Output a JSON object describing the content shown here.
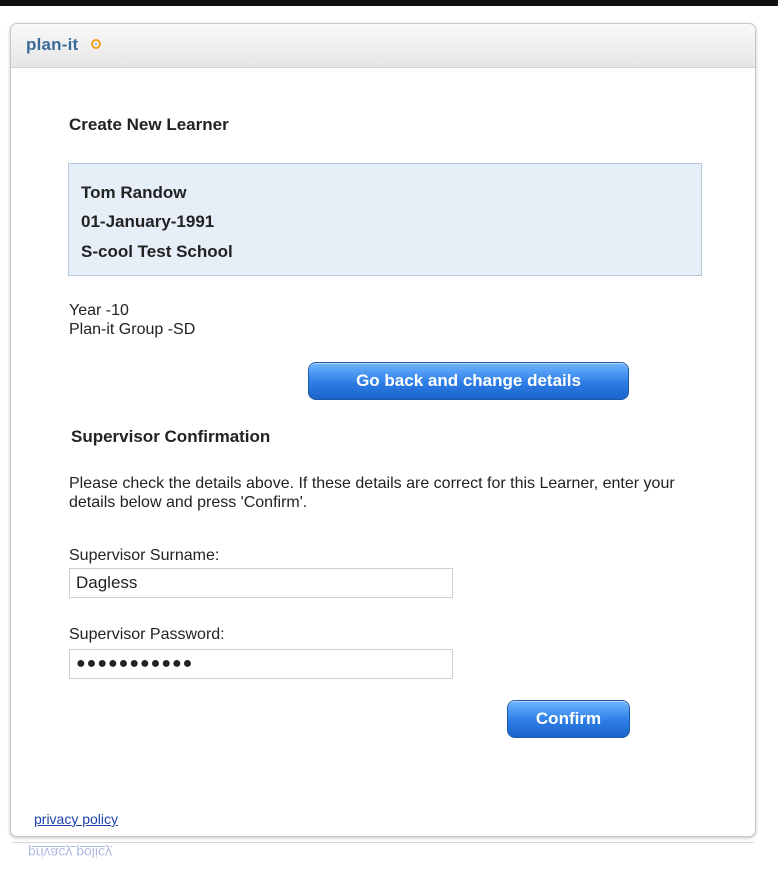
{
  "app": {
    "logo": "plan-it"
  },
  "page": {
    "title": "Create New Learner"
  },
  "learner": {
    "name": "Tom Randow",
    "dob": "01-January-1991",
    "school": "S-cool Test School",
    "year": "Year -10",
    "group": "Plan-it Group -SD"
  },
  "buttons": {
    "go_back": "Go back and change details",
    "confirm": "Confirm"
  },
  "supervisor": {
    "heading": "Supervisor Confirmation",
    "instructions": "Please check the details above. If these details are correct for this Learner, enter your details below and press 'Confirm'.",
    "surname_label": "Supervisor Surname:",
    "surname_value": "Dagless",
    "password_label": "Supervisor Password:",
    "password_value": "●●●●●●●●●●●"
  },
  "footer": {
    "privacy": "privacy policy"
  },
  "colors": {
    "accent": "#2c7de6",
    "logo": "#3a6a99",
    "logo_ring": "#f2a51d",
    "learner_box": "#e6eef8"
  }
}
